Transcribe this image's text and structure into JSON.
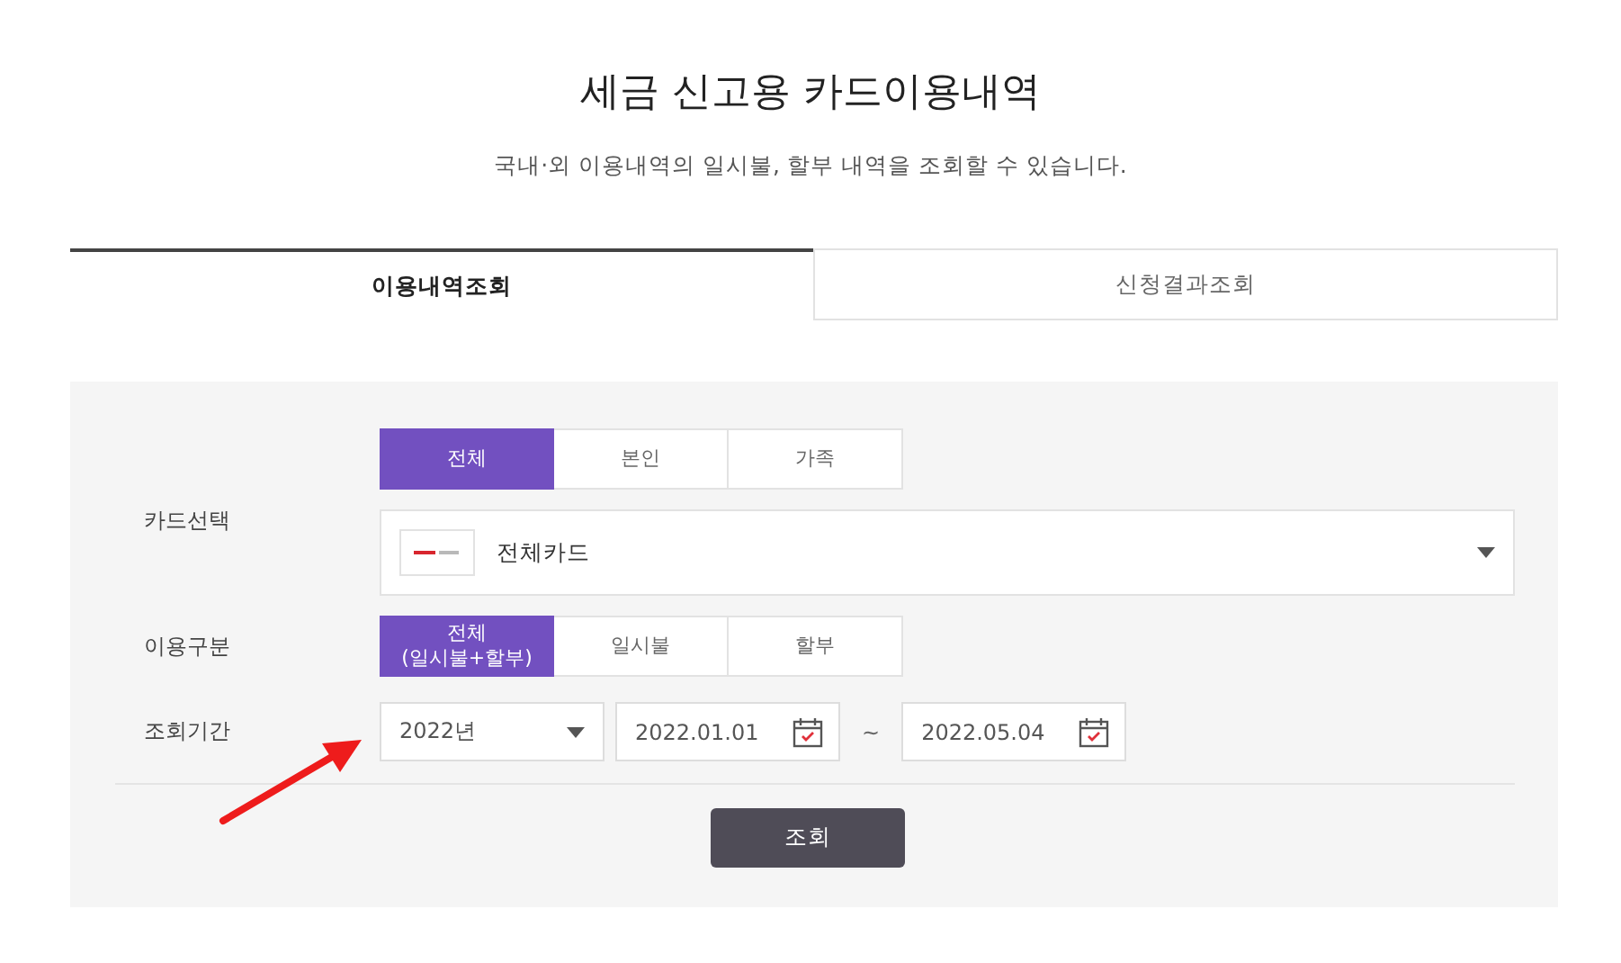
{
  "title": "세금 신고용 카드이용내역",
  "subtitle": "국내·외 이용내역의 일시불, 할부 내역을 조회할 수 있습니다.",
  "tabs": [
    {
      "label": "이용내역조회",
      "selected": true
    },
    {
      "label": "신청결과조회",
      "selected": false
    }
  ],
  "card_select": {
    "label": "카드선택",
    "options": [
      {
        "label": "전체",
        "selected": true
      },
      {
        "label": "본인",
        "selected": false
      },
      {
        "label": "가족",
        "selected": false
      }
    ],
    "card": "전체카드"
  },
  "usage_type": {
    "label": "이용구분",
    "options": [
      {
        "label": "전체\n(일시불+할부)",
        "selected": true
      },
      {
        "label": "일시불",
        "selected": false
      },
      {
        "label": "할부",
        "selected": false
      }
    ]
  },
  "period": {
    "label": "조회기간",
    "year": "2022년",
    "start": "2022.01.01",
    "separator": "~",
    "end": "2022.05.04"
  },
  "search_button": "조회"
}
